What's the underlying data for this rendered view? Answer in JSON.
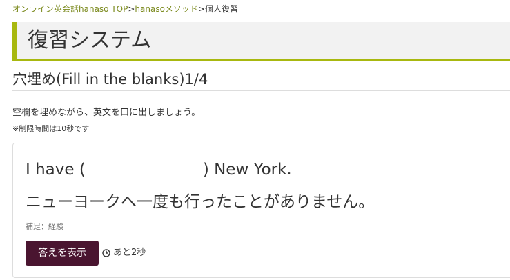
{
  "breadcrumb": {
    "home": "オンライン英会話hanaso TOP",
    "sep1": ">",
    "method": "hanasoメソッド",
    "sep2": ">",
    "current": "個人復習"
  },
  "page_title": "復習システム",
  "section_title": "穴埋め(Fill in the blanks)1/4",
  "instruction": "空欄を埋めながら、英文を口に出しましょう。",
  "note": "※制限時間は10秒です",
  "question": {
    "english_before": "I have (",
    "english_after": ") New York.",
    "japanese": "ニューヨークへ一度も行ったことがありません。",
    "hint": "補足：経験"
  },
  "show_answer_label": "答えを表示",
  "timer_text": "あと2秒",
  "icons": {
    "timer": "clock-icon"
  },
  "colors": {
    "accent": "#a8b80f",
    "link": "#7b8a1e",
    "button": "#4a1530"
  }
}
